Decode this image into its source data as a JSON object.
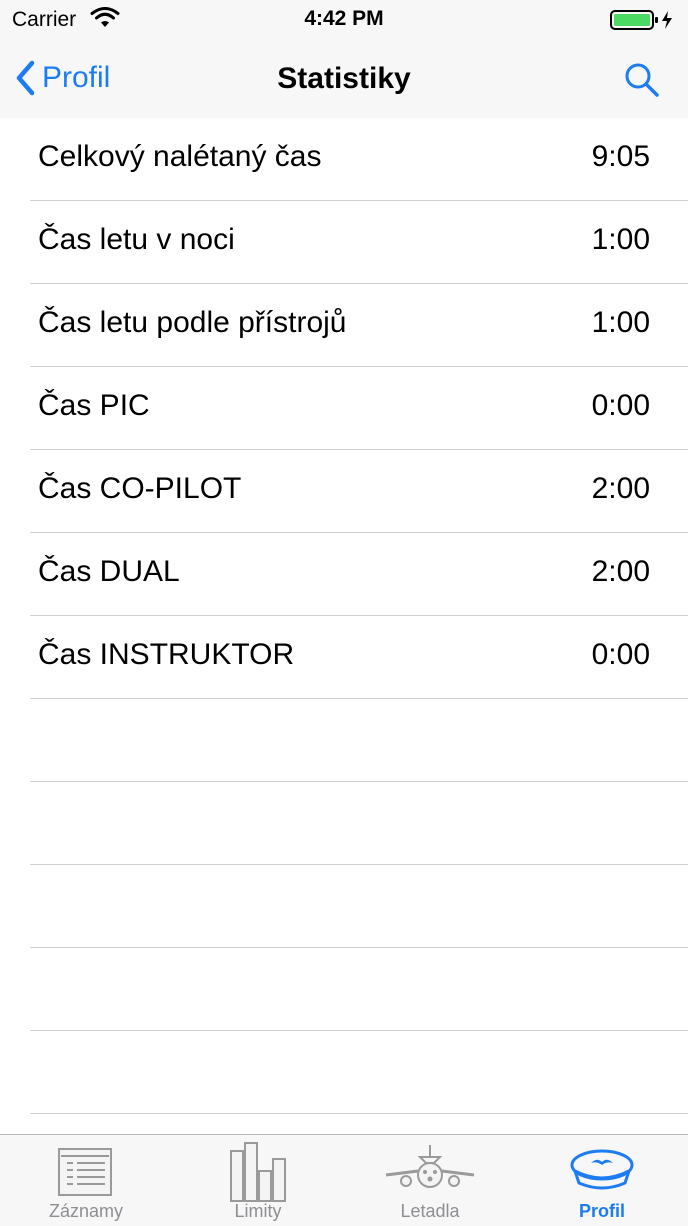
{
  "status_bar": {
    "carrier": "Carrier",
    "time": "4:42 PM",
    "battery_color": "#4cd964"
  },
  "nav": {
    "back_label": "Profil",
    "title": "Statistiky",
    "accent": "#1e7cf2"
  },
  "stats": [
    {
      "label": "Celkový nalétaný čas",
      "value": "9:05"
    },
    {
      "label": "Čas letu v noci",
      "value": "1:00"
    },
    {
      "label": "Čas letu podle přístrojů",
      "value": "1:00"
    },
    {
      "label": "Čas PIC",
      "value": "0:00"
    },
    {
      "label": "Čas CO-PILOT",
      "value": "2:00"
    },
    {
      "label": "Čas DUAL",
      "value": "2:00"
    },
    {
      "label": "Čas INSTRUKTOR",
      "value": "0:00"
    }
  ],
  "tabs": [
    {
      "label": "Záznamy",
      "icon": "list-icon",
      "active": false
    },
    {
      "label": "Limity",
      "icon": "bar-chart-icon",
      "active": false
    },
    {
      "label": "Letadla",
      "icon": "airplane-icon",
      "active": false
    },
    {
      "label": "Profil",
      "icon": "pilot-cap-icon",
      "active": true
    }
  ]
}
